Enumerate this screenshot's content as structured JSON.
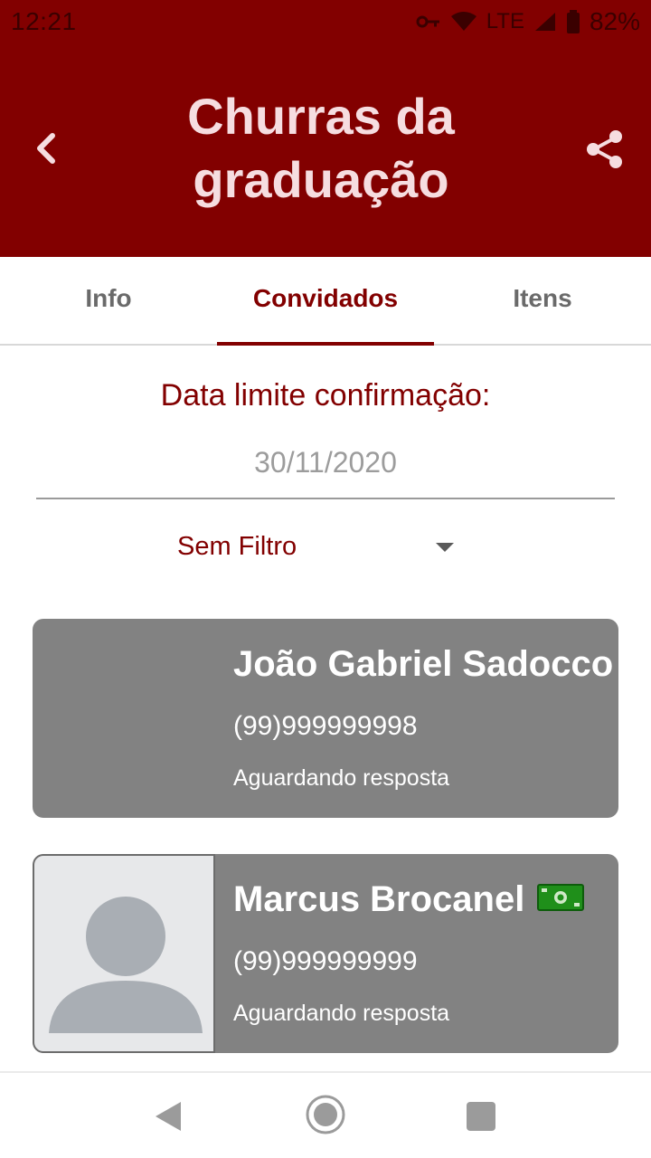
{
  "status_bar": {
    "time": "12:21",
    "network": "LTE",
    "battery": "82%"
  },
  "header": {
    "title": "Churras da graduação",
    "back_icon": "chevron-left-icon",
    "share_icon": "share-icon"
  },
  "tabs": [
    {
      "label": "Info",
      "active": false
    },
    {
      "label": "Convidados",
      "active": true
    },
    {
      "label": "Itens",
      "active": false
    }
  ],
  "deadline": {
    "label": "Data limite confirmação:",
    "value": "30/11/2020"
  },
  "filter": {
    "selected": "Sem Filtro"
  },
  "guests": [
    {
      "name": "João Gabriel Sadocco",
      "phone": "(99)999999998",
      "status": "Aguardando resposta",
      "has_avatar_placeholder": false
    },
    {
      "name": "Marcus Brocanel",
      "phone": "(99)999999999",
      "status": "Aguardando resposta",
      "has_avatar_placeholder": true,
      "badge_icon": "money-bill-icon"
    }
  ],
  "colors": {
    "primary": "#820000",
    "card_bg": "#828282",
    "title_text": "#f6dde0"
  }
}
